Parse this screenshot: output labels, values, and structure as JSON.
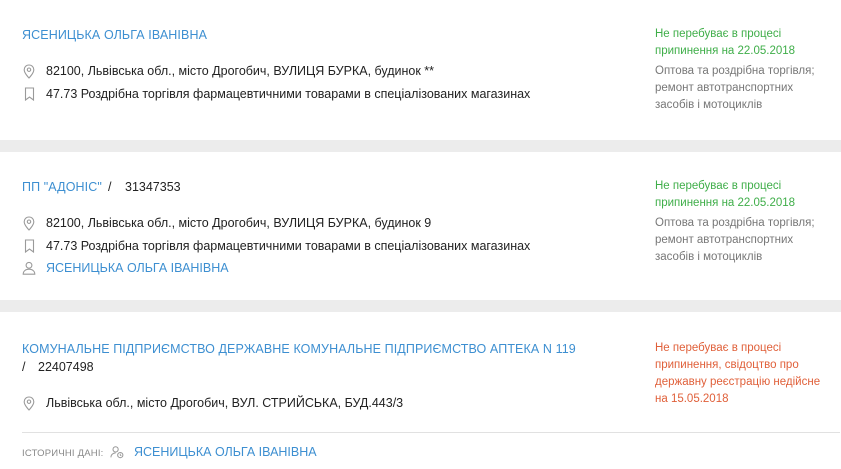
{
  "entries": [
    {
      "name": "ЯСЕНИЦЬКА ОЛЬГА ІВАНІВНА",
      "address": "82100, Львівська обл., місто Дрогобич, ВУЛИЦЯ БУРКА, будинок **",
      "kved": "47.73 Роздрібна торгівля фармацевтичними товарами в спеціалізованих магазинах",
      "status_lines": [
        "Не перебуває в процесі",
        "припинення на 22.05.2018"
      ],
      "activity_lines": [
        "Оптова та роздрібна торгівля;",
        "ремонт автотранспортних",
        "засобів і мотоциклів"
      ]
    },
    {
      "name": "ПП \"АДОНІС\"",
      "separator": "/",
      "code": "31347353",
      "address": "82100, Львівська обл., місто Дрогобич, ВУЛИЦЯ БУРКА, будинок 9",
      "kved": "47.73 Роздрібна торгівля фармацевтичними товарами в спеціалізованих магазинах",
      "person": "ЯСЕНИЦЬКА ОЛЬГА ІВАНІВНА",
      "status_lines": [
        "Не перебуває в процесі",
        "припинення на 22.05.2018"
      ],
      "activity_lines": [
        "Оптова та роздрібна торгівля;",
        "ремонт автотранспортних",
        "засобів і мотоциклів"
      ]
    },
    {
      "name": "КОМУНАЛЬНЕ ПІДПРИЄМСТВО ДЕРЖАВНЕ КОМУНАЛЬНЕ ПІДПРИЄМСТВО АПТЕКА N 119",
      "separator": "/",
      "code": "22407498",
      "address": "Львівська обл., місто Дрогобич, ВУЛ. СТРИЙСЬКА, БУД.443/3",
      "status_lines": [
        "Не перебуває в процесі",
        "припинення, свідоцтво про",
        "державну реєстрацію недійсне",
        "на 15.05.2018"
      ],
      "history_label": "ІСТОРИЧНІ ДАНІ:",
      "history_person": "ЯСЕНИЦЬКА ОЛЬГА ІВАНІВНА"
    }
  ],
  "colors": {
    "link": "#3d8fd1",
    "status_active": "#3fae49",
    "status_terminated": "#e0603a",
    "muted": "#777777",
    "separator": "#ececec"
  },
  "icons": {
    "address": "map-pin-icon",
    "kved": "bookmark-icon",
    "person": "user-icon",
    "history": "user-history-icon"
  }
}
